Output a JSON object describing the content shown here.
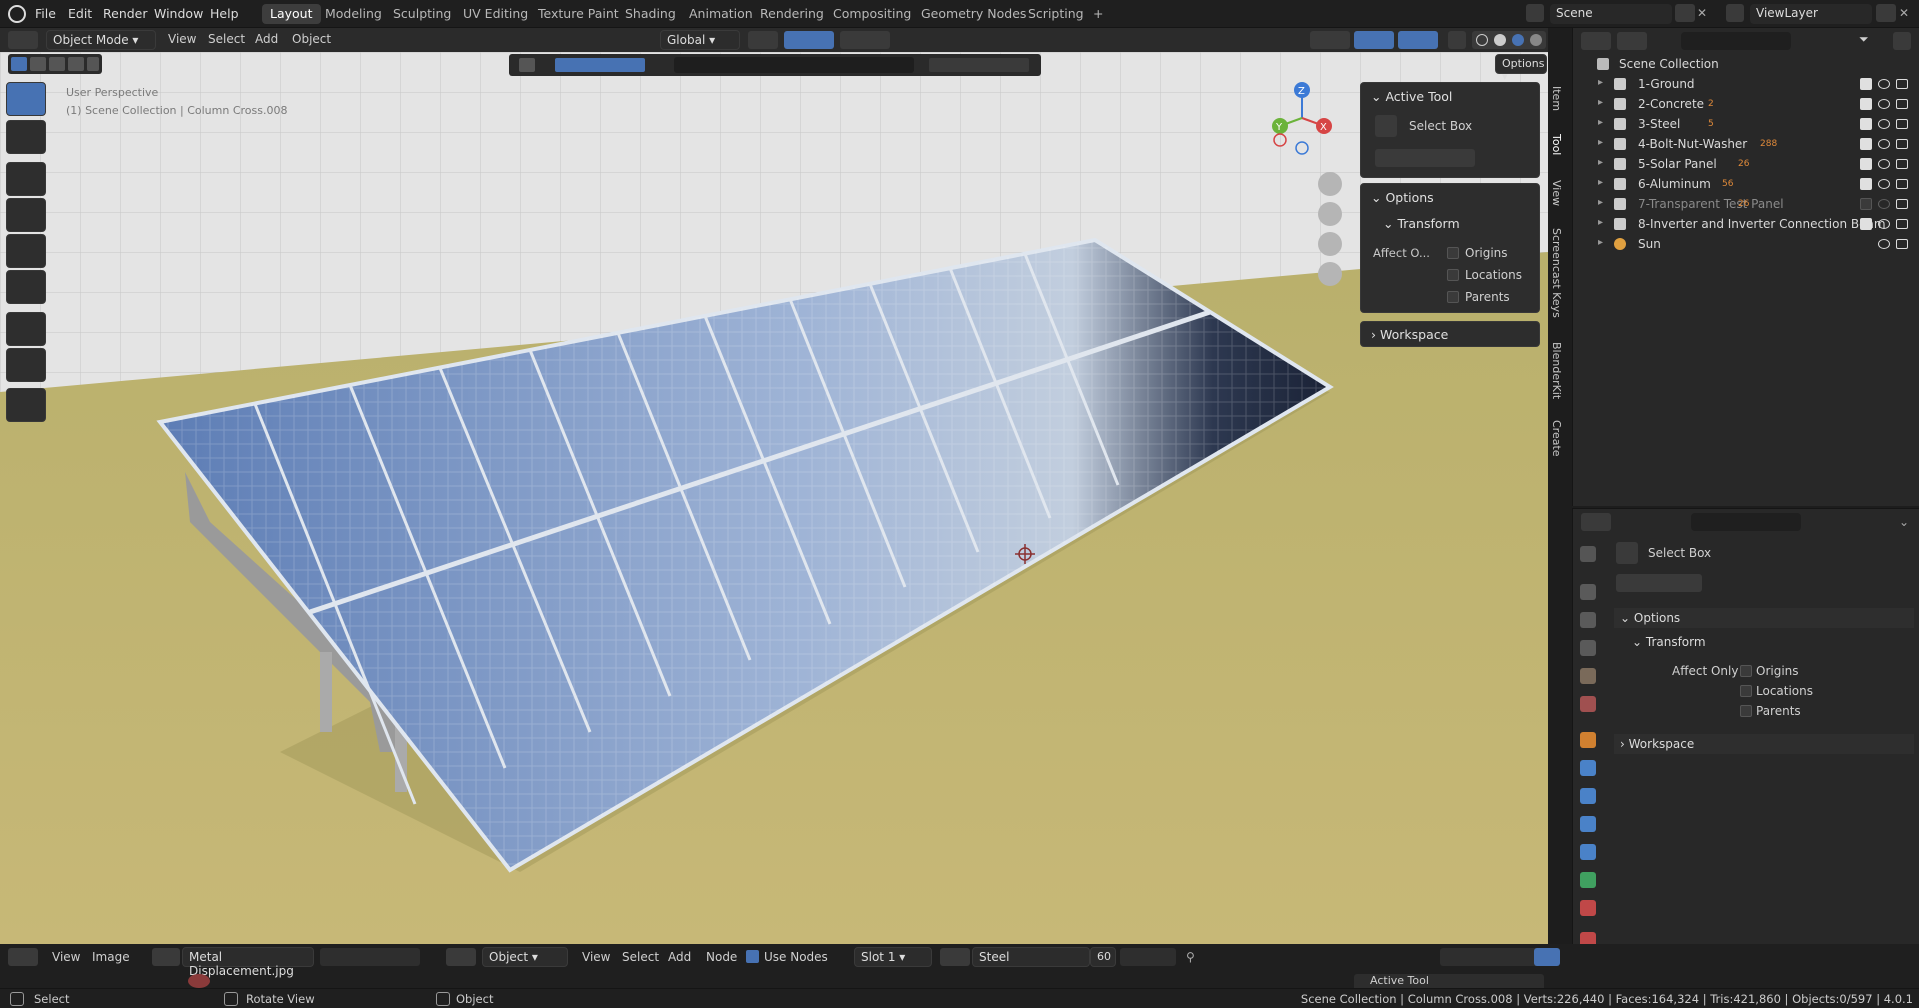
{
  "menu": {
    "items": [
      "File",
      "Edit",
      "Render",
      "Window",
      "Help"
    ],
    "workspaces": [
      "Layout",
      "Modeling",
      "Sculpting",
      "UV Editing",
      "Texture Paint",
      "Shading",
      "Animation",
      "Rendering",
      "Compositing",
      "Geometry Nodes",
      "Scripting"
    ],
    "active_workspace": "Layout",
    "scene": "Scene",
    "view_layer": "ViewLayer"
  },
  "viewport_header": {
    "mode": "Object Mode",
    "menus": [
      "View",
      "Select",
      "Add",
      "Object"
    ],
    "orientation": "Global",
    "options": "Options"
  },
  "viewport": {
    "perspective": "User Perspective",
    "context": "(1) Scene Collection | Column Cross.008",
    "gizmo": {
      "x": "X",
      "y": "Y",
      "z": "Z"
    }
  },
  "npanel": {
    "active_tool_title": "Active Tool",
    "tool_name": "Select Box",
    "options_title": "Options",
    "transform_title": "Transform",
    "affect_label": "Affect O...",
    "affect_options": [
      "Origins",
      "Locations",
      "Parents"
    ],
    "workspace_title": "Workspace"
  },
  "side_tabs": [
    "Item",
    "Tool",
    "View",
    "Screencast Keys",
    "BlenderKit",
    "Create"
  ],
  "outliner": {
    "root": "Scene Collection",
    "items": [
      {
        "name": "1-Ground",
        "badge": ""
      },
      {
        "name": "2-Concrete",
        "badge": "2"
      },
      {
        "name": "3-Steel",
        "badge": "5"
      },
      {
        "name": "4-Bolt-Nut-Washer",
        "badge": "288"
      },
      {
        "name": "5-Solar Panel",
        "badge": "26"
      },
      {
        "name": "6-Aluminum",
        "badge": "56"
      },
      {
        "name": "7-Transparent Test Panel",
        "badge": "26"
      },
      {
        "name": "8-Inverter and Inverter Connection Beam",
        "badge": ""
      },
      {
        "name": "Sun",
        "badge": ""
      }
    ]
  },
  "properties": {
    "tool_name": "Select Box",
    "options_title": "Options",
    "transform_title": "Transform",
    "affect_only": "Affect Only",
    "affect_options": [
      "Origins",
      "Locations",
      "Parents"
    ],
    "workspace_title": "Workspace"
  },
  "bottom": {
    "image_menus": [
      "View",
      "Image"
    ],
    "image_name": "Metal Displacement.jpg",
    "shader_type": "Object",
    "node_menus": [
      "View",
      "Select",
      "Add",
      "Node"
    ],
    "use_nodes": "Use Nodes",
    "slot": "Slot 1",
    "material": "Steel",
    "users": "60",
    "mini_active_tool": "Active Tool"
  },
  "status": {
    "select": "Select",
    "rotate": "Rotate View",
    "object": "Object",
    "stats": "Scene Collection | Column Cross.008 | Verts:226,440 | Faces:164,324 | Tris:421,860 | Objects:0/597 | 4.0.1"
  },
  "colors": {
    "accent": "#4772b3",
    "collection_icon": "#e08a3a",
    "ground": "#c9b870"
  }
}
